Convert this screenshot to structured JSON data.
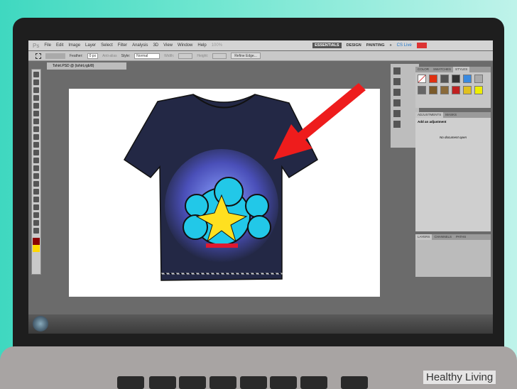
{
  "menu": {
    "app": "Ps",
    "items": [
      "File",
      "Edit",
      "Image",
      "Layer",
      "Select",
      "Filter",
      "Analysis",
      "3D",
      "View",
      "Window",
      "Help"
    ],
    "zoom": "100%"
  },
  "workspaces": {
    "active": "ESSENTIALS",
    "others": [
      "DESIGN",
      "PAINTING"
    ],
    "more": "»",
    "cslive": "CS Live"
  },
  "options": {
    "feather_label": "Feather:",
    "feather_value": "0 px",
    "antialias": "Anti-alias",
    "style_label": "Style:",
    "style_value": "Normal",
    "width_label": "Width:",
    "height_label": "Height:",
    "refine": "Refine Edge..."
  },
  "document": {
    "tab": "Tshirt.PSD @ (tshirt,rgb/8)"
  },
  "panels": {
    "top_tabs": [
      "COLOR",
      "SWATCHES",
      "STYLES"
    ],
    "active_top": "STYLES",
    "adj_tabs": [
      "ADJUSTMENTS",
      "MASKS"
    ],
    "adj_title": "Add an adjustment",
    "adj_msg": "No document open",
    "bottom_tabs": [
      "LAYERS",
      "CHANNELS",
      "PATHS"
    ]
  },
  "colors": {
    "arrow": "#ee1c1c",
    "shirt": "#232845"
  },
  "watermark": "Healthy Living"
}
